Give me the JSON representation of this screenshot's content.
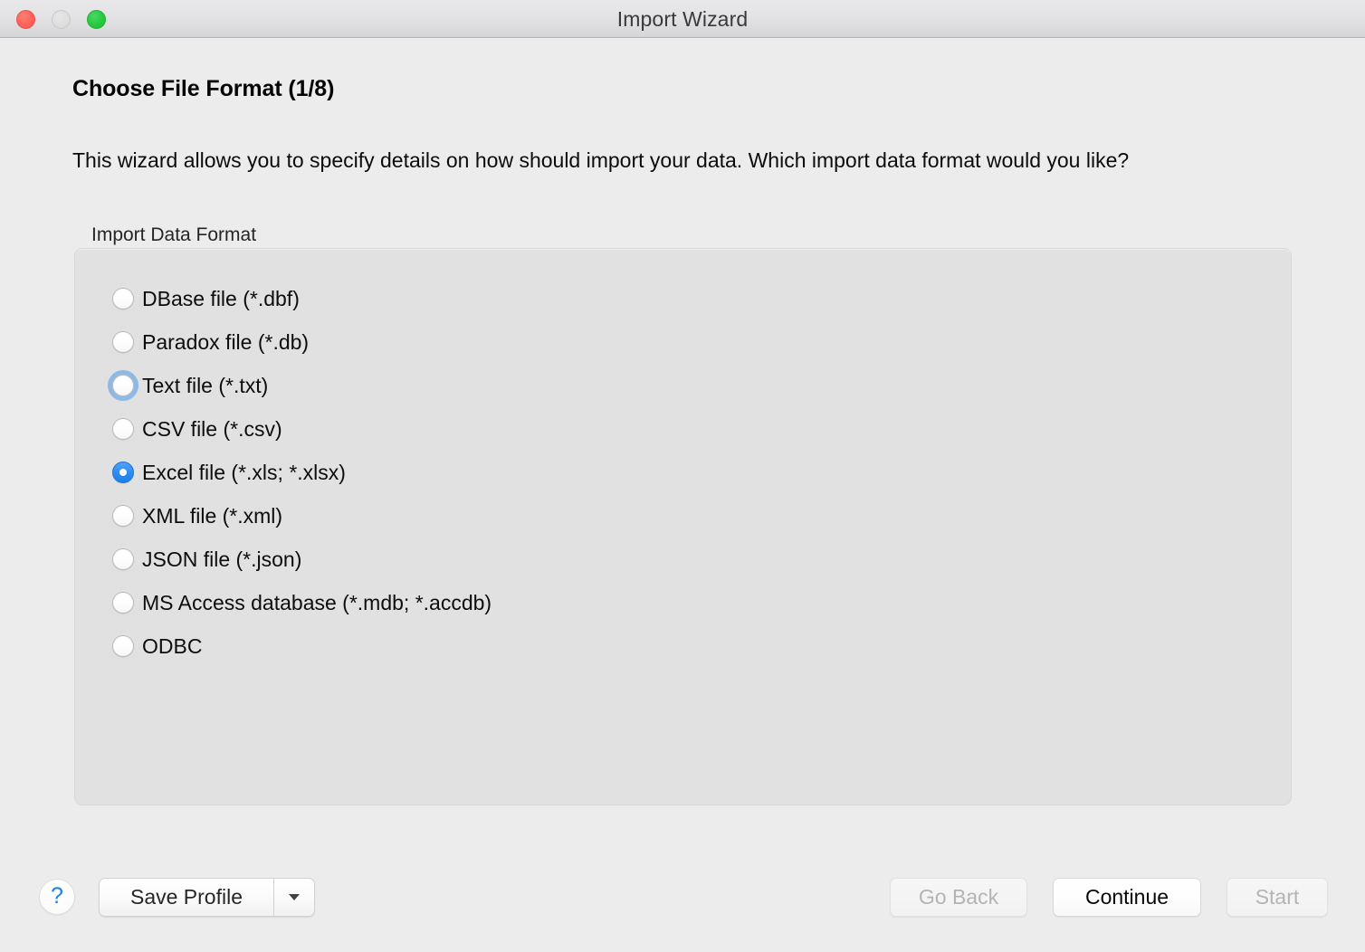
{
  "window": {
    "title": "Import Wizard",
    "traffic_lights": [
      {
        "name": "close",
        "color": "#ff6159"
      },
      {
        "name": "minimize",
        "color": "#dcdcdc"
      },
      {
        "name": "maximize",
        "color": "#28c940"
      }
    ]
  },
  "page": {
    "heading": "Choose File Format (1/8)",
    "description": "This wizard allows you to specify details on how should import your data. Which import data format would you like?"
  },
  "group": {
    "label": "Import Data Format",
    "options": [
      {
        "label": "DBase file (*.dbf)",
        "checked": false,
        "focused": false
      },
      {
        "label": "Paradox file (*.db)",
        "checked": false,
        "focused": false
      },
      {
        "label": "Text file (*.txt)",
        "checked": false,
        "focused": true
      },
      {
        "label": "CSV file (*.csv)",
        "checked": false,
        "focused": false
      },
      {
        "label": "Excel file (*.xls; *.xlsx)",
        "checked": true,
        "focused": false
      },
      {
        "label": "XML file (*.xml)",
        "checked": false,
        "focused": false
      },
      {
        "label": "JSON file (*.json)",
        "checked": false,
        "focused": false
      },
      {
        "label": "MS Access database (*.mdb; *.accdb)",
        "checked": false,
        "focused": false
      },
      {
        "label": "ODBC",
        "checked": false,
        "focused": false
      }
    ],
    "selected_value": "Excel file (*.xls; *.xlsx)"
  },
  "footer": {
    "help_label": "?",
    "save_profile_label": "Save Profile",
    "save_profile_menu_icon": "chevron-down-icon",
    "go_back_label": "Go Back",
    "go_back_enabled": false,
    "continue_label": "Continue",
    "continue_enabled": true,
    "start_label": "Start",
    "start_enabled": false
  },
  "colors": {
    "window_background": "#ececec",
    "groupbox_background": "#e1e1e1",
    "accent": "#2e8cf0",
    "focus_ring": "#58a0e9",
    "help_glyph": "#1a7ff0",
    "disabled_text": "#b4b4b6"
  }
}
